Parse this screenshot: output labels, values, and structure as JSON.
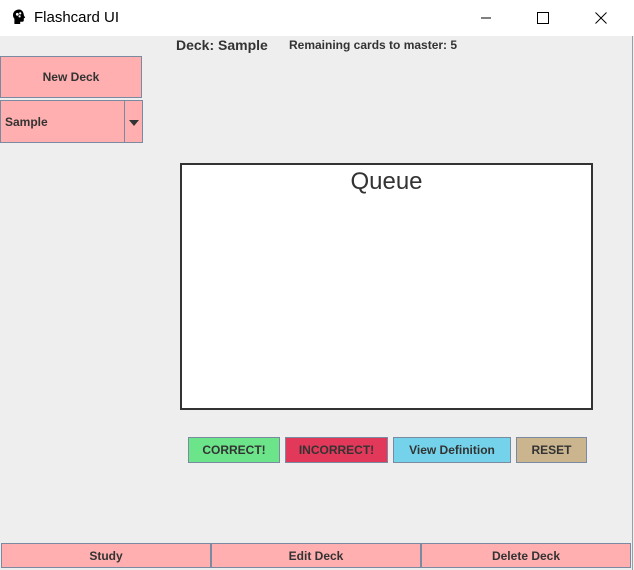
{
  "window": {
    "title": "Flashcard UI",
    "icons": {
      "app": "brain-head-icon",
      "minimize": "minimize-icon",
      "maximize": "maximize-icon",
      "close": "close-icon"
    }
  },
  "header": {
    "deck_label": "Deck: Sample",
    "remaining_label": "Remaining cards to master: 5"
  },
  "sidebar": {
    "new_deck_label": "New Deck",
    "deck_select": {
      "selected": "Sample",
      "arrow_icon": "caret-down-icon"
    }
  },
  "card": {
    "title": "Queue"
  },
  "actions": {
    "correct_label": "CORRECT!",
    "incorrect_label": "INCORRECT!",
    "view_definition_label": "View Definition",
    "reset_label": "RESET"
  },
  "bottom_bar": {
    "study_label": "Study",
    "edit_deck_label": "Edit Deck",
    "delete_deck_label": "Delete Deck"
  },
  "colors": {
    "pink_button": "#ffafaf",
    "correct": "#6ce58a",
    "incorrect": "#e2395a",
    "view_definition": "#74d3ea",
    "reset": "#cbb58f"
  }
}
